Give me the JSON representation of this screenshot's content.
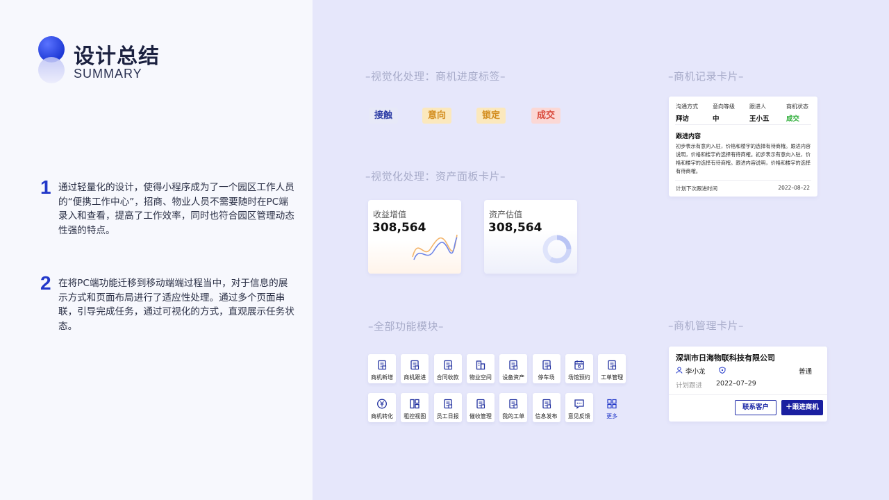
{
  "header": {
    "title": "设计总结",
    "subtitle": "SUMMARY"
  },
  "points": [
    {
      "num": "1",
      "text": "通过轻量化的设计，使得小程序成为了一个园区工作人员的“便携工作中心”，招商、物业人员不需要随时在PC端录入和查看，提高了工作效率，同时也符合园区管理动态性强的特点。"
    },
    {
      "num": "2",
      "text": "在将PC端功能迁移到移动端端过程当中，对于信息的展示方式和页面布局进行了适应性处理。通过多个页面串联，引导完成任务，通过可视化的方式，直观展示任务状态。"
    }
  ],
  "sections": {
    "tags": "–视觉化处理：商机进度标签–",
    "asset": "–视觉化处理：资产面板卡片–",
    "modules": "–全部功能模块–",
    "record": "–商机记录卡片–",
    "manage": "–商机管理卡片–"
  },
  "tags": [
    "接触",
    "意向",
    "锁定",
    "成交"
  ],
  "asset_cards": [
    {
      "label": "收益增值",
      "value": "308,564"
    },
    {
      "label": "资产估值",
      "value": "308,564"
    }
  ],
  "modules": [
    {
      "label": "商机新增",
      "icon": "business-add-icon"
    },
    {
      "label": "商机跟进",
      "icon": "follow-up-icon"
    },
    {
      "label": "合同收款",
      "icon": "contract-icon"
    },
    {
      "label": "物业空间",
      "icon": "building-icon"
    },
    {
      "label": "设备资产",
      "icon": "device-icon"
    },
    {
      "label": "停车场",
      "icon": "parking-icon"
    },
    {
      "label": "场馆预约",
      "icon": "calendar-icon"
    },
    {
      "label": "工单管理",
      "icon": "work-order-icon"
    },
    {
      "label": "商机转化",
      "icon": "yuan-icon"
    },
    {
      "label": "租控视图",
      "icon": "grid-view-icon"
    },
    {
      "label": "员工日报",
      "icon": "report-icon"
    },
    {
      "label": "催收管理",
      "icon": "collection-icon"
    },
    {
      "label": "我的工单",
      "icon": "my-order-icon"
    },
    {
      "label": "信息发布",
      "icon": "publish-icon"
    },
    {
      "label": "意见反馈",
      "icon": "feedback-icon"
    },
    {
      "label": "更多",
      "icon": "more-icon"
    }
  ],
  "record_card": {
    "cols": [
      {
        "k": "沟通方式",
        "v": "拜访"
      },
      {
        "k": "意向等级",
        "v": "中"
      },
      {
        "k": "跟进人",
        "v": "王小五"
      },
      {
        "k": "商机状态",
        "v": "成交"
      }
    ],
    "follow_title": "跟进内容",
    "follow_body": "初步表示有意向入驻，价格和楼宇的选择有待商榷。跟进内容说明，价格和楼宇的选择有待商榷。初步表示有意向入驻，价格和楼宇的选择有待商榷。跟进内容说明，价格和楼宇的选择有待商榷。",
    "next_label": "计划下次跟进时间",
    "next_date": "2022–08–22"
  },
  "manage_card": {
    "company": "深圳市日海物联科技有限公司",
    "person": "李小龙",
    "level": "普通",
    "plan_label": "计划跟进",
    "plan_date": "2022–07–29",
    "btn_contact": "联系客户",
    "btn_follow": "＋跟进商机"
  },
  "colors": {
    "accent": "#2238c9",
    "bg": "#e6e7fb",
    "green": "#2fae3a"
  }
}
